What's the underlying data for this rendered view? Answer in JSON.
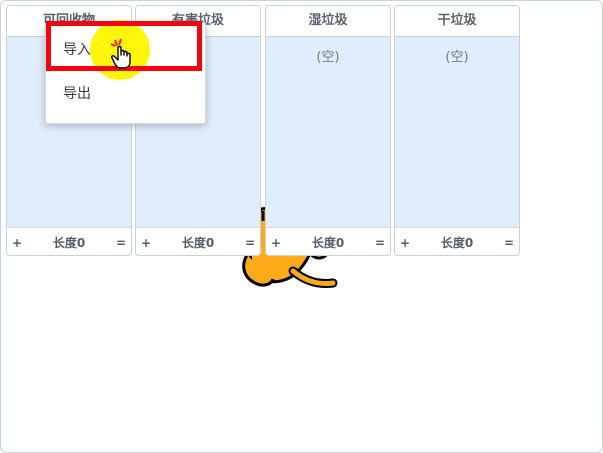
{
  "lists": [
    {
      "title": "可回收物",
      "empty": "",
      "add": "+",
      "length": "长度0",
      "resize": "="
    },
    {
      "title": "有害垃圾",
      "empty": "",
      "add": "+",
      "length": "长度0",
      "resize": "="
    },
    {
      "title": "湿垃圾",
      "empty": "(空)",
      "add": "+",
      "length": "长度0",
      "resize": "="
    },
    {
      "title": "干垃圾",
      "empty": "(空)",
      "add": "+",
      "length": "长度0",
      "resize": "="
    }
  ],
  "context_menu": {
    "import_label": "导入",
    "export_label": "导出"
  },
  "colors": {
    "list_body": "#e0edfd",
    "highlight": "#f2060d",
    "click_marker": "#fff600",
    "sprite": "#ffab19"
  },
  "icons": [
    "cat-sprite",
    "hand-pointer-icon"
  ]
}
